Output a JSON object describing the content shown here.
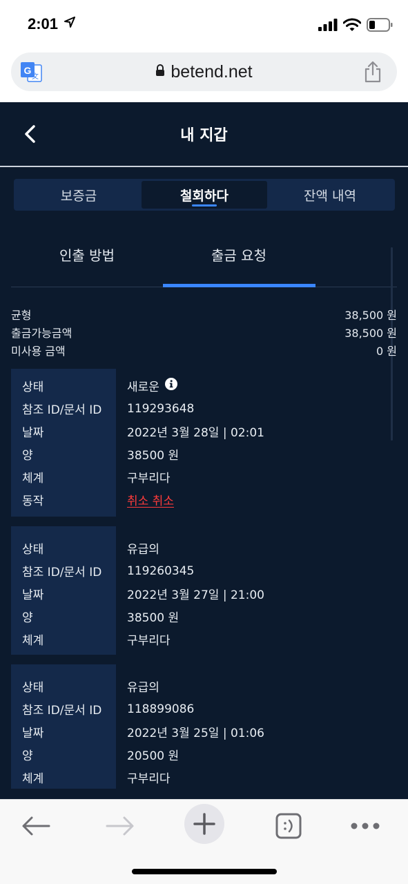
{
  "status_bar": {
    "time": "2:01"
  },
  "browser": {
    "url": "betend.net"
  },
  "header": {
    "title": "내 지갑"
  },
  "tabs": [
    {
      "label": "보증금"
    },
    {
      "label": "철회하다"
    },
    {
      "label": "잔액 내역"
    }
  ],
  "subtabs": [
    {
      "label": "인출 방법"
    },
    {
      "label": "출금 요청"
    }
  ],
  "summary": [
    {
      "label": "균형",
      "value": "38,500 원"
    },
    {
      "label": "출금가능금액",
      "value": "38,500 원"
    },
    {
      "label": "미사용 금액",
      "value": "0 원"
    }
  ],
  "records": [
    {
      "rows": [
        {
          "label": "상태",
          "value": "새로운"
        },
        {
          "label": "참조 ID/문서 ID",
          "value": "119293648"
        },
        {
          "label": "날짜",
          "value": "2022년 3월 28일 | 02:01"
        },
        {
          "label": "양",
          "value": "38500 원"
        },
        {
          "label": "체계",
          "value": "구부리다"
        },
        {
          "label": "동작",
          "value": "취소 취소"
        }
      ]
    },
    {
      "rows": [
        {
          "label": "상태",
          "value": "유급의"
        },
        {
          "label": "참조 ID/문서 ID",
          "value": "119260345"
        },
        {
          "label": "날짜",
          "value": "2022년 3월 27일 | 21:00"
        },
        {
          "label": "양",
          "value": "38500 원"
        },
        {
          "label": "체계",
          "value": "구부리다"
        }
      ]
    },
    {
      "rows": [
        {
          "label": "상태",
          "value": "유급의"
        },
        {
          "label": "참조 ID/문서 ID",
          "value": "118899086"
        },
        {
          "label": "날짜",
          "value": "2022년 3월 25일 | 01:06"
        },
        {
          "label": "양",
          "value": "20500 원"
        },
        {
          "label": "체계",
          "value": "구부리다"
        }
      ]
    }
  ],
  "colors": {
    "app_background": "#0c1a2d",
    "panel": "#14294a",
    "accent": "#3a86ff",
    "cancel": "#ff3b3b"
  }
}
